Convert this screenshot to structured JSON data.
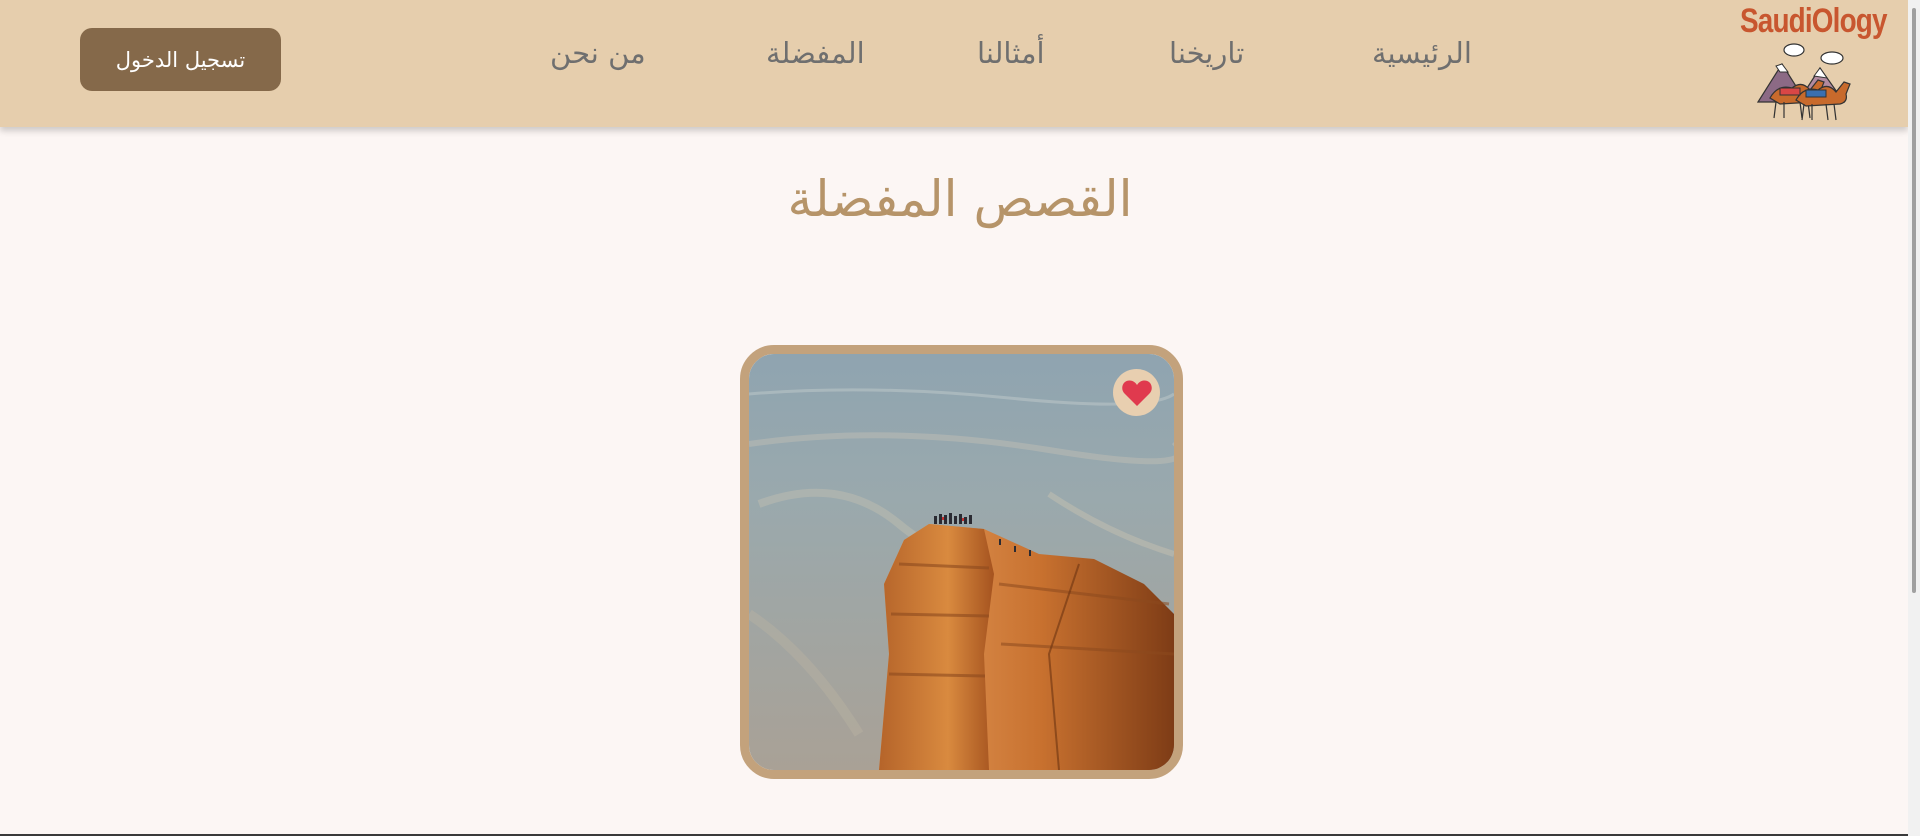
{
  "brand": {
    "logo_text": "SaudiOlogy"
  },
  "nav": {
    "home": "الرئيسية",
    "history": "تاريخنا",
    "proverbs": "أمثالنا",
    "favorites": "المفضلة",
    "about": "من نحن"
  },
  "auth": {
    "login_label": "تسجيل الدخول"
  },
  "main": {
    "title": "القصص المفضلة",
    "stories": [
      {
        "favorited": true
      }
    ]
  },
  "colors": {
    "navbar": "#e6cead",
    "page_background": "#fcf6f4",
    "login_button": "#85694a",
    "title": "#b69469",
    "card_border": "#c3a27c",
    "heart": "#e03a4e",
    "logo": "#c8562f"
  }
}
